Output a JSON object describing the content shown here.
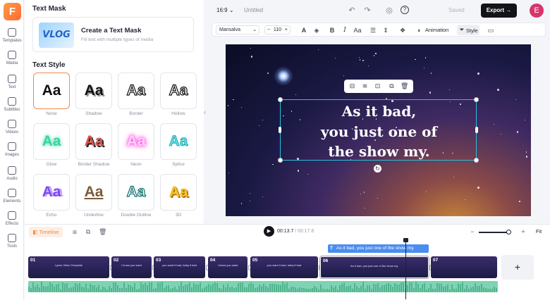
{
  "app": {
    "logo": "F"
  },
  "rail": [
    {
      "label": "Templates",
      "icon": "templates-icon"
    },
    {
      "label": "Media",
      "icon": "media-icon"
    },
    {
      "label": "Text",
      "icon": "text-icon"
    },
    {
      "label": "Subtitles",
      "icon": "subtitles-icon"
    },
    {
      "label": "Videos",
      "icon": "videos-icon"
    },
    {
      "label": "Images",
      "icon": "images-icon"
    },
    {
      "label": "Audio",
      "icon": "audio-icon"
    },
    {
      "label": "Elements",
      "icon": "elements-icon"
    },
    {
      "label": "Effects",
      "icon": "effects-icon"
    },
    {
      "label": "Tools",
      "icon": "tools-icon"
    }
  ],
  "panel": {
    "mask_heading": "Text Mask",
    "mask_thumb": "VLOG",
    "mask_title": "Create a Text Mask",
    "mask_sub": "Fill text with multiple types of media",
    "style_heading": "Text Style",
    "styles": [
      {
        "label": "None",
        "sample": "Aa"
      },
      {
        "label": "Shadow",
        "sample": "Aa"
      },
      {
        "label": "Border",
        "sample": "Aa"
      },
      {
        "label": "Hollow",
        "sample": "Aa"
      },
      {
        "label": "Glow",
        "sample": "Aa"
      },
      {
        "label": "Border Shadow",
        "sample": "Aa"
      },
      {
        "label": "Neon",
        "sample": "Aa"
      },
      {
        "label": "Splice",
        "sample": "Aa"
      },
      {
        "label": "Echo",
        "sample": "Aa"
      },
      {
        "label": "Underline",
        "sample": "Aa"
      },
      {
        "label": "Double Outline",
        "sample": "Aa"
      },
      {
        "label": "3D",
        "sample": "Aa"
      }
    ]
  },
  "topbar": {
    "ratio": "16:9",
    "title": "Untitled",
    "saved": "Saved",
    "export": "Export",
    "avatar": "E"
  },
  "format": {
    "font": "Mansalva",
    "size": "110",
    "animation": "Animation",
    "style": "Style"
  },
  "canvas": {
    "lines": [
      "As it bad,",
      "you just one of",
      "the show my."
    ]
  },
  "timeline": {
    "tab": "Timeline",
    "current_time": "00:13.7",
    "total_time": "/ 00:17.8",
    "fit": "Fit",
    "text_clip": "As it bad, you just one of the show my.",
    "zoom_level": 0.9,
    "clips": [
      {
        "num": "01",
        "caption": "Lyrics Video Template"
      },
      {
        "num": "02",
        "caption": "I know you want"
      },
      {
        "num": "03",
        "caption": "you want it bad, baby it bad"
      },
      {
        "num": "04",
        "caption": "I know you want"
      },
      {
        "num": "05",
        "caption": "you want it bad, baby it bad"
      },
      {
        "num": "06",
        "caption": "As it bad, you just one of the show my."
      },
      {
        "num": "07",
        "caption": ""
      }
    ]
  }
}
